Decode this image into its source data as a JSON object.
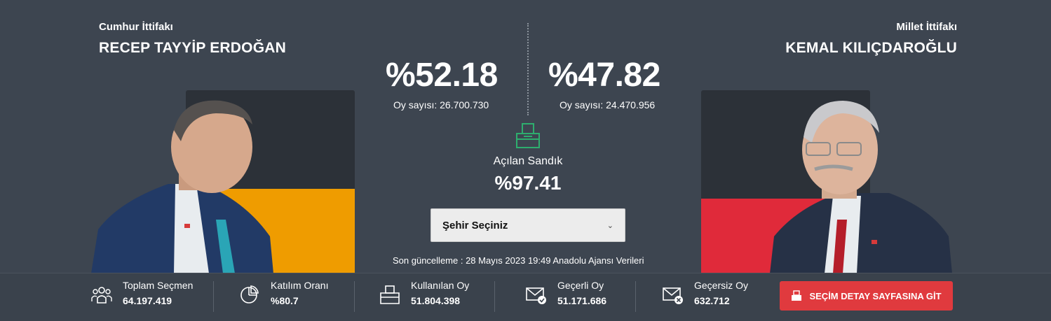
{
  "left_candidate": {
    "alliance": "Cumhur İttifakı",
    "name": "RECEP TAYYİP ERDOĞAN",
    "percent": "%52.18",
    "votes": "Oy sayısı: 26.700.730",
    "color": "#ef9c00",
    "vote_share": 0.5218
  },
  "right_candidate": {
    "alliance": "Millet İttifakı",
    "name": "KEMAL KILIÇDAROĞLU",
    "percent": "%47.82",
    "votes": "Oy sayısı: 24.470.956",
    "color": "#e02a3a",
    "vote_share": 0.4782
  },
  "ballot": {
    "label": "Açılan Sandık",
    "percent": "%97.41",
    "icon": "ballot-box-icon"
  },
  "city_select": {
    "selected": "Şehir Seçiniz"
  },
  "last_update": "Son güncelleme : 28 Mayıs 2023 19:49 Anadolu Ajansı Verileri",
  "stats": [
    {
      "label": "Toplam Seçmen",
      "value": "64.197.419",
      "icon": "people-icon"
    },
    {
      "label": "Katılım Oranı",
      "value": "%80.7",
      "icon": "pie-chart-icon"
    },
    {
      "label": "Kullanılan Oy",
      "value": "51.804.398",
      "icon": "ballot-box-icon"
    },
    {
      "label": "Geçerli Oy",
      "value": "51.171.686",
      "icon": "envelope-check-icon"
    },
    {
      "label": "Geçersiz Oy",
      "value": "632.712",
      "icon": "envelope-x-icon"
    }
  ],
  "detail_button": {
    "label": "SEÇİM DETAY SAYFASINA GİT",
    "color": "#e03a3e"
  }
}
